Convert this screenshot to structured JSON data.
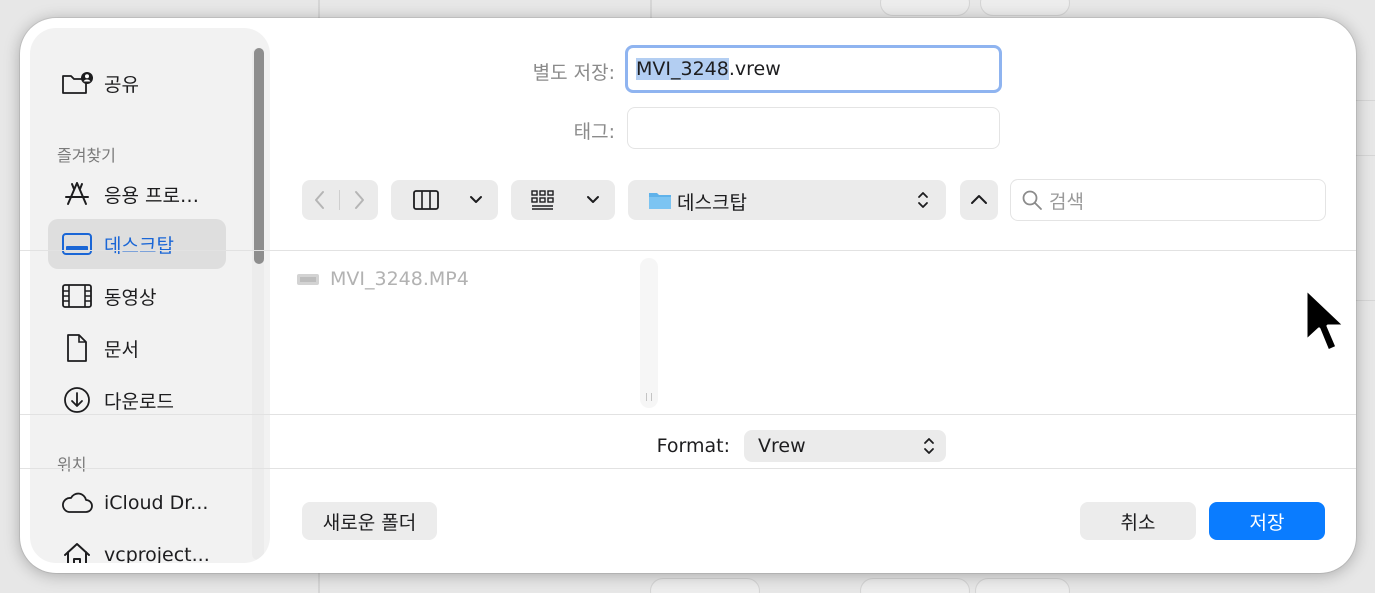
{
  "sidebar": {
    "share": {
      "label": "공유",
      "icon": "shared-folder-icon"
    },
    "favorites_header": "즐겨찾기",
    "favorites": [
      {
        "label": "응용 프로…",
        "icon": "applications-icon"
      },
      {
        "label": "데스크탑",
        "icon": "desktop-icon",
        "active": true
      },
      {
        "label": "동영상",
        "icon": "film-icon"
      },
      {
        "label": "문서",
        "icon": "document-icon"
      },
      {
        "label": "다운로드",
        "icon": "download-icon"
      }
    ],
    "locations_header": "위치",
    "locations": [
      {
        "label": "iCloud Dr...",
        "icon": "cloud-icon"
      },
      {
        "label": "vcproject...",
        "icon": "home-icon"
      }
    ]
  },
  "save_as": {
    "label": "별도 저장:",
    "value_selected": "MVI_3248",
    "value_rest": ".vrew"
  },
  "tags": {
    "label": "태그:",
    "value": ""
  },
  "toolbar": {
    "location": "데스크탑",
    "search_placeholder": "검색"
  },
  "files": [
    {
      "name": "MVI_3248.MP4",
      "dimmed": true
    }
  ],
  "format": {
    "label": "Format:",
    "value": "Vrew"
  },
  "buttons": {
    "new_folder": "새로운 폴더",
    "cancel": "취소",
    "save": "저장"
  },
  "colors": {
    "accent": "#0a7cff",
    "active_text": "#1a66d6",
    "focus_ring": "#8fb4f0",
    "folder": "#5fb2ea"
  }
}
